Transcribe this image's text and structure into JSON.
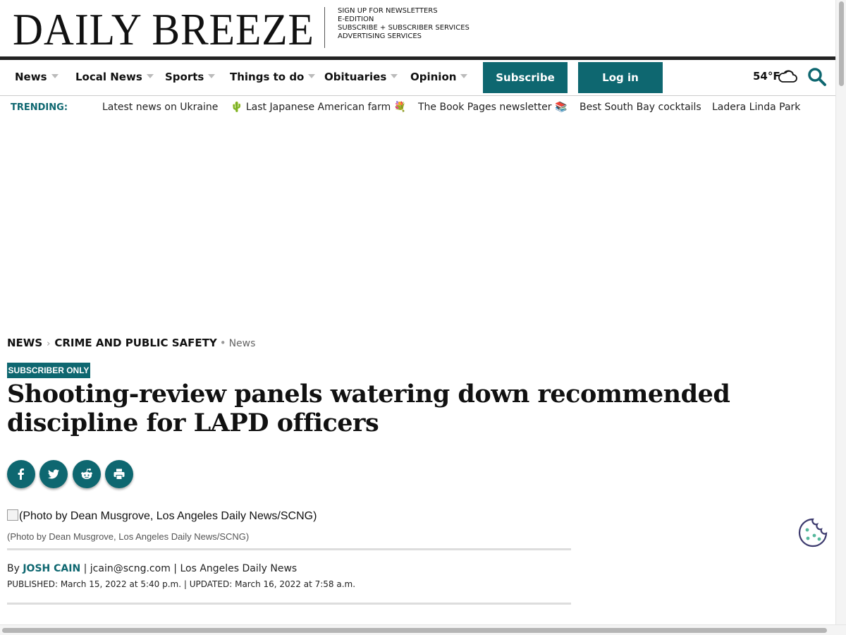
{
  "masthead": {
    "logo": "DAILY BREEZE",
    "links": [
      "SIGN UP FOR NEWSLETTERS",
      "E-EDITION",
      "SUBSCRIBE + SUBSCRIBER SERVICES",
      "ADVERTISING SERVICES"
    ]
  },
  "nav": {
    "items": [
      "News",
      "Local News",
      "Sports",
      "Things to do",
      "Obituaries",
      "Opinion"
    ],
    "subscribe_label": "Subscribe",
    "login_label": "Log in",
    "temperature": "54°F",
    "weather_icon": "cloud-icon",
    "accent_color": "#0e6770"
  },
  "trending": {
    "label": "TRENDING:",
    "items": [
      "Latest news on Ukraine",
      "🌵 Last Japanese American farm 💐",
      "The Book Pages newsletter 📚",
      "Best South Bay cocktails",
      "Ladera Linda Park"
    ]
  },
  "article": {
    "breadcrumb": {
      "section": "NEWS",
      "subsection": "CRIME AND PUBLIC SAFETY",
      "tag": "News"
    },
    "badge": "SUBSCRIBER ONLY",
    "headline": "Shooting-review panels watering down recommended discipline for LAPD officers",
    "share_buttons": [
      "facebook-icon",
      "twitter-icon",
      "reddit-icon",
      "print-icon"
    ],
    "photo_alt": "(Photo by Dean Musgrove, Los Angeles Daily News/SCNG)",
    "photo_caption": "(Photo by Dean Musgrove, Los Angeles Daily News/SCNG)",
    "byline": {
      "prefix": "By",
      "author": "Josh Cain",
      "email": "jcain@scng.com",
      "outlet": "Los Angeles Daily News"
    },
    "published_label": "PUBLISHED:",
    "published": "March 15, 2022 at 5:40 p.m.",
    "updated_label": "UPDATED:",
    "updated": "March 16, 2022 at 7:58 a.m."
  }
}
